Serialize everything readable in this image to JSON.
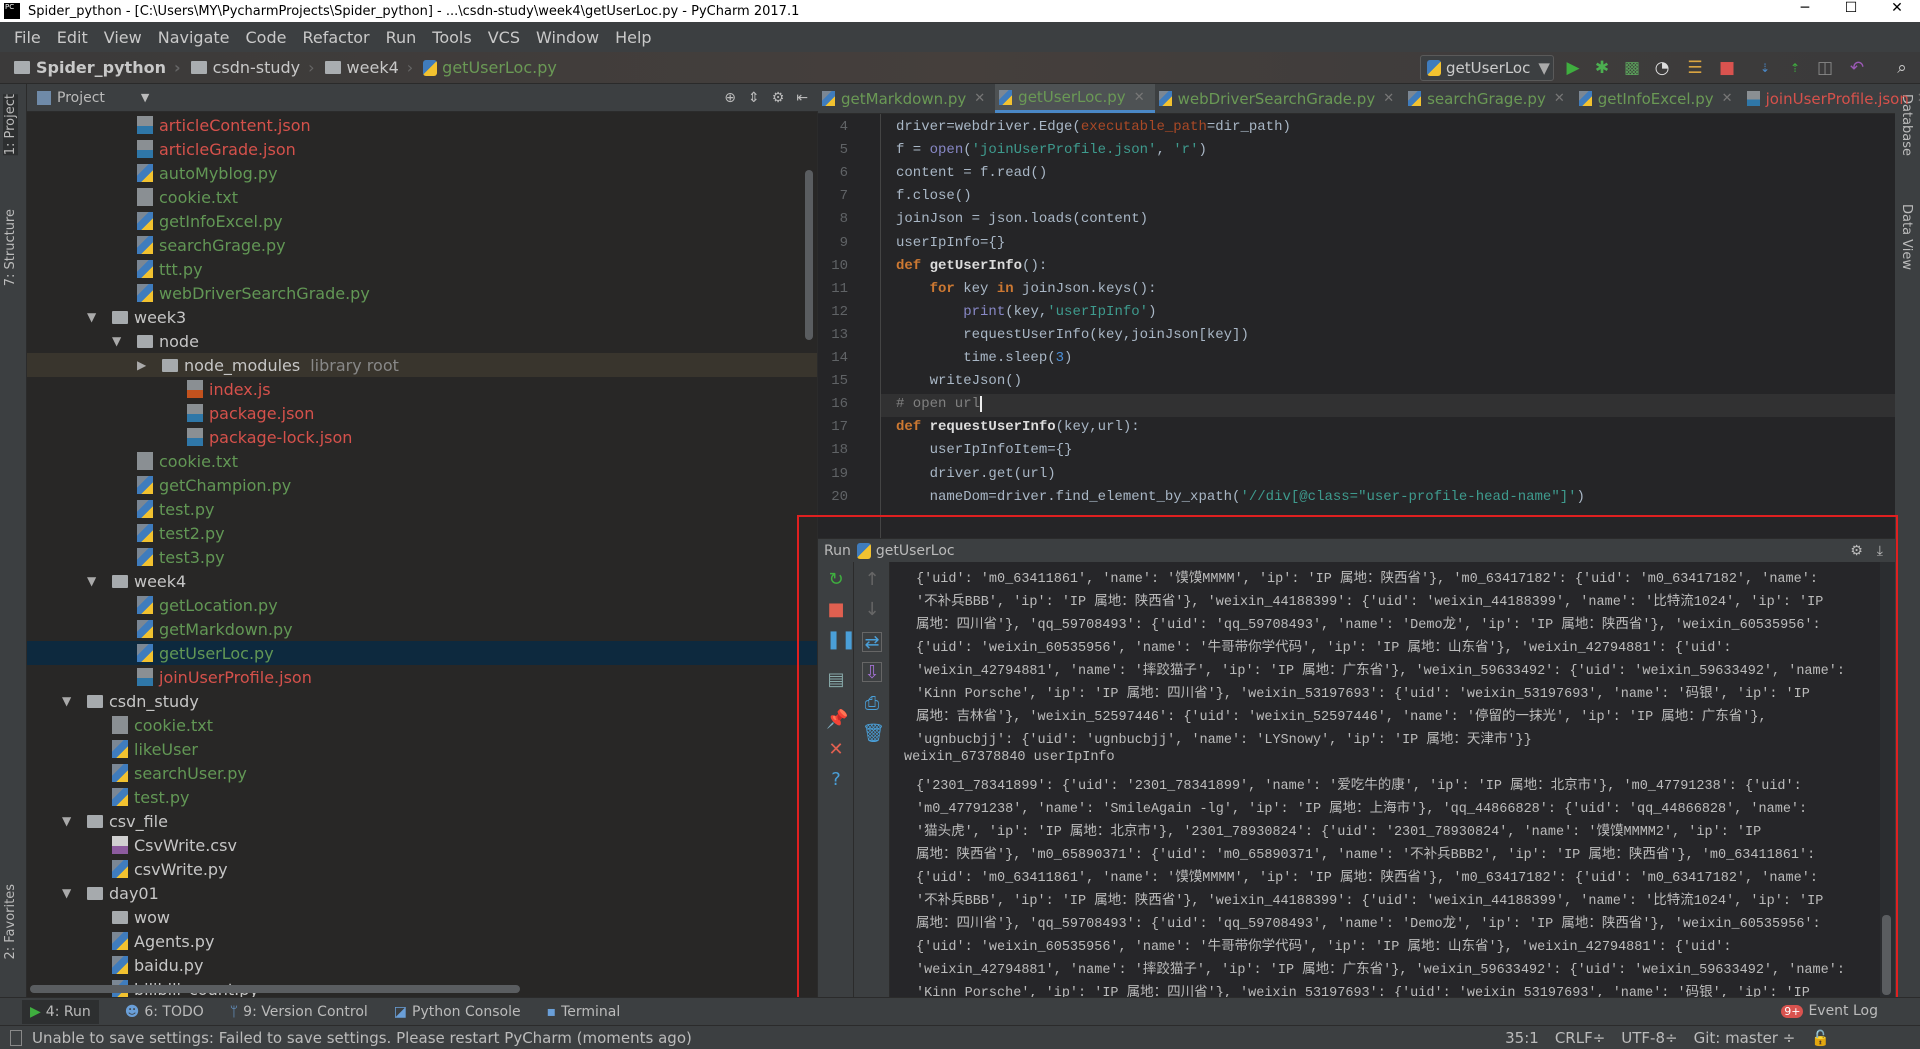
{
  "window": {
    "title": "Spider_python - [C:\\Users\\MY\\PycharmProjects\\Spider_python] - ...\\csdn-study\\week4\\getUserLoc.py - PyCharm 2017.1",
    "minimize": "─",
    "maximize": "☐",
    "close": "✕"
  },
  "menu": [
    "File",
    "Edit",
    "View",
    "Navigate",
    "Code",
    "Refactor",
    "Run",
    "Tools",
    "VCS",
    "Window",
    "Help"
  ],
  "breadcrumb": [
    "Spider_python",
    "csdn-study",
    "week4",
    "getUserLoc.py"
  ],
  "run_config": "getUserLoc",
  "left_stripe": {
    "project": "1: Project",
    "structure": "7: Structure",
    "favorites": "2: Favorites"
  },
  "right_stripe": {
    "database": "Database",
    "dataview": "Data View"
  },
  "project_panel": {
    "title": "Project",
    "tree": [
      {
        "label": "articleContent.json",
        "type": "json",
        "level": 2,
        "color": "red"
      },
      {
        "label": "articleGrade.json",
        "type": "json",
        "level": 2,
        "color": "red"
      },
      {
        "label": "autoMyblog.py",
        "type": "py",
        "level": 2,
        "color": "green"
      },
      {
        "label": "cookie.txt",
        "type": "txt",
        "level": 2,
        "color": "green"
      },
      {
        "label": "getInfoExcel.py",
        "type": "py",
        "level": 2,
        "color": "green"
      },
      {
        "label": "searchGrage.py",
        "type": "py",
        "level": 2,
        "color": "green"
      },
      {
        "label": "ttt.py",
        "type": "py",
        "level": 2,
        "color": "green"
      },
      {
        "label": "webDriverSearchGrade.py",
        "type": "py",
        "level": 2,
        "color": "green"
      },
      {
        "label": "week3",
        "type": "folder",
        "level": 1,
        "color": "white",
        "expanded": true
      },
      {
        "label": "node",
        "type": "folder",
        "level": 2,
        "color": "white",
        "expanded": true
      },
      {
        "label": "node_modules",
        "type": "folder",
        "level": 3,
        "color": "white",
        "expanded": false,
        "suffix": "library root",
        "highlight": true
      },
      {
        "label": "index.js",
        "type": "js",
        "level": 4,
        "color": "red"
      },
      {
        "label": "package.json",
        "type": "json",
        "level": 4,
        "color": "red"
      },
      {
        "label": "package-lock.json",
        "type": "json",
        "level": 4,
        "color": "red"
      },
      {
        "label": "cookie.txt",
        "type": "txt",
        "level": 2,
        "color": "green"
      },
      {
        "label": "getChampion.py",
        "type": "py",
        "level": 2,
        "color": "green"
      },
      {
        "label": "test.py",
        "type": "py",
        "level": 2,
        "color": "green"
      },
      {
        "label": "test2.py",
        "type": "py",
        "level": 2,
        "color": "green"
      },
      {
        "label": "test3.py",
        "type": "py",
        "level": 2,
        "color": "green"
      },
      {
        "label": "week4",
        "type": "folder",
        "level": 1,
        "color": "white",
        "expanded": true
      },
      {
        "label": "getLocation.py",
        "type": "py",
        "level": 2,
        "color": "green"
      },
      {
        "label": "getMarkdown.py",
        "type": "py",
        "level": 2,
        "color": "green"
      },
      {
        "label": "getUserLoc.py",
        "type": "py",
        "level": 2,
        "color": "green",
        "selected": true
      },
      {
        "label": "joinUserProfile.json",
        "type": "json",
        "level": 2,
        "color": "red"
      },
      {
        "label": "csdn_study",
        "type": "folder",
        "level": 0,
        "color": "white",
        "expanded": true
      },
      {
        "label": "cookie.txt",
        "type": "txt",
        "level": 1,
        "color": "green"
      },
      {
        "label": "likeUser",
        "type": "py",
        "level": 1,
        "color": "green"
      },
      {
        "label": "searchUser.py",
        "type": "py",
        "level": 1,
        "color": "green"
      },
      {
        "label": "test.py",
        "type": "py",
        "level": 1,
        "color": "green"
      },
      {
        "label": "csv_file",
        "type": "folder",
        "level": 0,
        "color": "white",
        "expanded": true
      },
      {
        "label": "CsvWrite.csv",
        "type": "csv",
        "level": 1,
        "color": "white"
      },
      {
        "label": "csvWrite.py",
        "type": "py",
        "level": 1,
        "color": "white"
      },
      {
        "label": "day01",
        "type": "folder",
        "level": 0,
        "color": "white",
        "expanded": true
      },
      {
        "label": "wow",
        "type": "folder",
        "level": 1,
        "color": "white",
        "leaf": true
      },
      {
        "label": "Agents.py",
        "type": "py",
        "level": 1,
        "color": "white"
      },
      {
        "label": "baidu.py",
        "type": "py",
        "level": 1,
        "color": "white"
      },
      {
        "label": "bilibili_count.py",
        "type": "py",
        "level": 1,
        "color": "white"
      }
    ]
  },
  "editor": {
    "tabs": [
      {
        "label": "getMarkdown.py",
        "type": "py"
      },
      {
        "label": "getUserLoc.py",
        "type": "py",
        "active": true
      },
      {
        "label": "webDriverSearchGrade.py",
        "type": "py"
      },
      {
        "label": "searchGrage.py",
        "type": "py"
      },
      {
        "label": "getInfoExcel.py",
        "type": "py"
      },
      {
        "label": "joinUserProfile.json",
        "type": "json"
      }
    ],
    "tab_overflow": "▾≡2",
    "current_line": 16,
    "lines": [
      {
        "n": "4",
        "tokens": [
          [
            "driver=webdriver.Edge(",
            ""
          ],
          [
            "executable_path",
            "pa"
          ],
          [
            "=dir_path)",
            ""
          ]
        ]
      },
      {
        "n": "5",
        "tokens": [
          [
            "f = ",
            ""
          ],
          [
            "open",
            "bi"
          ],
          [
            "(",
            ""
          ],
          [
            "'joinUserProfile.json'",
            "st"
          ],
          [
            ", ",
            ""
          ],
          [
            "'r'",
            "st"
          ],
          [
            ")",
            ""
          ]
        ]
      },
      {
        "n": "6",
        "tokens": [
          [
            "content = f.read()",
            ""
          ]
        ]
      },
      {
        "n": "7",
        "tokens": [
          [
            "f.close()",
            ""
          ]
        ]
      },
      {
        "n": "8",
        "tokens": [
          [
            "joinJson = json.loads(content)",
            ""
          ]
        ]
      },
      {
        "n": "9",
        "tokens": [
          [
            "userIpInfo={}",
            ""
          ]
        ]
      },
      {
        "n": "10",
        "tokens": [
          [
            "def",
            "kw"
          ],
          [
            " ",
            ""
          ],
          [
            "getUserInfo",
            "fn"
          ],
          [
            "():",
            ""
          ]
        ]
      },
      {
        "n": "11",
        "tokens": [
          [
            "    ",
            ""
          ],
          [
            "for",
            "kw"
          ],
          [
            " key ",
            ""
          ],
          [
            "in",
            "kw"
          ],
          [
            " joinJson.keys():",
            ""
          ]
        ]
      },
      {
        "n": "12",
        "tokens": [
          [
            "        ",
            ""
          ],
          [
            "print",
            "bi"
          ],
          [
            "(key,",
            ""
          ],
          [
            "'userIpInfo'",
            "st"
          ],
          [
            ")",
            ""
          ]
        ]
      },
      {
        "n": "13",
        "tokens": [
          [
            "        requestUserInfo(key,joinJson[key])",
            ""
          ]
        ]
      },
      {
        "n": "14",
        "tokens": [
          [
            "        time.sleep(",
            ""
          ],
          [
            "3",
            "nu"
          ],
          [
            ")",
            ""
          ]
        ]
      },
      {
        "n": "15",
        "tokens": [
          [
            "    writeJson()",
            ""
          ]
        ]
      },
      {
        "n": "16",
        "tokens": [
          [
            "# open url",
            "cm"
          ]
        ]
      },
      {
        "n": "17",
        "tokens": [
          [
            "def",
            "kw"
          ],
          [
            " ",
            ""
          ],
          [
            "requestUserInfo",
            "fn"
          ],
          [
            "(key,url):",
            ""
          ]
        ]
      },
      {
        "n": "18",
        "tokens": [
          [
            "    userIpInfoItem={}",
            ""
          ]
        ]
      },
      {
        "n": "19",
        "tokens": [
          [
            "    driver.get(url)",
            ""
          ]
        ]
      },
      {
        "n": "20",
        "tokens": [
          [
            "    nameDom=driver.find_element_by_xpath(",
            ""
          ],
          [
            "'//div[@class=\"user-profile-head-name\"]'",
            "st"
          ],
          [
            ")",
            ""
          ]
        ]
      }
    ]
  },
  "run": {
    "label": "Run",
    "config": "getUserLoc",
    "output": [
      "{'uid': 'm0_63411861', 'name': '馍馍MMMM', 'ip': 'IP 属地：陕西省'}, 'm0_63417182': {'uid': 'm0_63417182', 'name':",
      "'不补兵BBB', 'ip': 'IP 属地：陕西省'}, 'weixin_44188399': {'uid': 'weixin_44188399', 'name': '比特流1024', 'ip': 'IP",
      "属地：四川省'}, 'qq_59708493': {'uid': 'qq_59708493', 'name': 'Demo龙', 'ip': 'IP 属地：陕西省'}, 'weixin_60535956':",
      "{'uid': 'weixin_60535956', 'name': '牛哥带你学代码', 'ip': 'IP 属地：山东省'}, 'weixin_42794881': {'uid':",
      "'weixin_42794881', 'name': '摔跤猫子', 'ip': 'IP 属地：广东省'}, 'weixin_59633492': {'uid': 'weixin_59633492', 'name':",
      "'Kinn Porsche', 'ip': 'IP 属地：四川省'}, 'weixin_53197693': {'uid': 'weixin_53197693', 'name': '码银', 'ip': 'IP",
      "属地：吉林省'}, 'weixin_52597446': {'uid': 'weixin_52597446', 'name': '停留的一抹光', 'ip': 'IP 属地：广东省'},",
      "'ugnbucbjj': {'uid': 'ugnbucbjj', 'name': 'LYSnowy', 'ip': 'IP 属地：天津市'}}",
      "weixin_67378840 userIpInfo",
      "{'2301_78341899': {'uid': '2301_78341899', 'name': '爱吃牛的康', 'ip': 'IP 属地：北京市'}, 'm0_47791238': {'uid':",
      "'m0_47791238', 'name': 'SmileAgain -lg', 'ip': 'IP 属地：上海市'}, 'qq_44866828': {'uid': 'qq_44866828', 'name':",
      "'猫头虎', 'ip': 'IP 属地：北京市'}, '2301_78930824': {'uid': '2301_78930824', 'name': '馍馍MMMM2', 'ip': 'IP",
      "属地：陕西省'}, 'm0_65890371': {'uid': 'm0_65890371', 'name': '不补兵BBB2', 'ip': 'IP 属地：陕西省'}, 'm0_63411861':",
      "{'uid': 'm0_63411861', 'name': '馍馍MMMM', 'ip': 'IP 属地：陕西省'}, 'm0_63417182': {'uid': 'm0_63417182', 'name':",
      "'不补兵BBB', 'ip': 'IP 属地：陕西省'}, 'weixin_44188399': {'uid': 'weixin_44188399', 'name': '比特流1024', 'ip': 'IP",
      "属地：四川省'}, 'qq_59708493': {'uid': 'qq_59708493', 'name': 'Demo龙', 'ip': 'IP 属地：陕西省'}, 'weixin_60535956':",
      "{'uid': 'weixin_60535956', 'name': '牛哥带你学代码', 'ip': 'IP 属地：山东省'}, 'weixin_42794881': {'uid':",
      "'weixin_42794881', 'name': '摔跤猫子', 'ip': 'IP 属地：广东省'}, 'weixin_59633492': {'uid': 'weixin_59633492', 'name':",
      "'Kinn Porsche', 'ip': 'IP 属地：四川省'}, 'weixin_53197693': {'uid': 'weixin_53197693', 'name': '码银', 'ip': 'IP"
    ]
  },
  "bottom_tabs": [
    {
      "label": "4: Run",
      "icon": "▶",
      "active": true
    },
    {
      "label": "6: TODO",
      "icon": "☻"
    },
    {
      "label": "9: Version Control",
      "icon": "ᛘ"
    },
    {
      "label": "Python Console",
      "icon": "◪"
    },
    {
      "label": "Terminal",
      "icon": "▪"
    }
  ],
  "event_log": {
    "badge": "9+",
    "label": "Event Log"
  },
  "status": {
    "message": "Unable to save settings: Failed to save settings. Please restart PyCharm (moments ago)",
    "position": "35:1",
    "line_sep": "CRLF÷",
    "encoding": "UTF-8÷",
    "vcs": "Git: master ÷"
  },
  "colors": {
    "accent": "#4a88c7",
    "json_file": "#d5514b",
    "py_file": "#629755",
    "highlight_box": "#e02020"
  }
}
